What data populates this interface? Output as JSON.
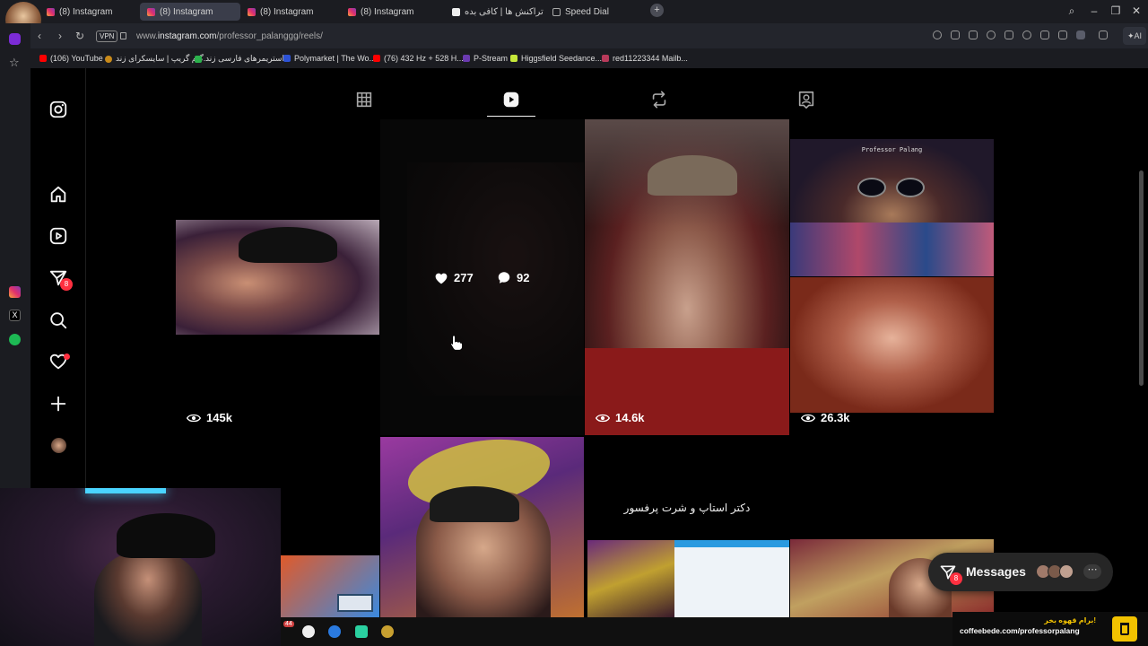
{
  "tabs": [
    {
      "label": "(8) Instagram"
    },
    {
      "label": "(8) Instagram"
    },
    {
      "label": "(8) Instagram"
    },
    {
      "label": "(8) Instagram"
    },
    {
      "label": "تراکنش ها | کافی بده"
    },
    {
      "label": "Speed Dial"
    }
  ],
  "address": {
    "vpn": "VPN",
    "url_prefix": "www.",
    "url_domain": "instagram.com",
    "url_path": "/professor_palanggg/reels/"
  },
  "bookmarks": [
    {
      "label": "(106) YouTube"
    },
    {
      "label": "گیم گریپ | سایسکرای زند..."
    },
    {
      "label": "استریمرهای فارسی زند..."
    },
    {
      "label": "Polymarket | The Wo..."
    },
    {
      "label": "(76) 432 Hz + 528 H..."
    },
    {
      "label": "P-Stream"
    },
    {
      "label": "Higgsfield Seedance..."
    },
    {
      "label": "red11223344 Mailb..."
    }
  ],
  "nav": {
    "notifications_badge": "8"
  },
  "grid": {
    "reel1_views": "145k",
    "reel2_likes": "277",
    "reel2_comments": "92",
    "reel3_views": "14.6k",
    "reel4_views": "26.3k",
    "reel4_caption": "Professor Palang",
    "reel7_caption": "دکتر استاپ و شرت پرفسور"
  },
  "messages": {
    "label": "Messages",
    "badge": "8"
  },
  "overlay": {
    "coffee_title": "برام قهوه بخر!",
    "coffee_url": "coffeebede.com/professorpalang",
    "taskbar_count": "44"
  },
  "colors": {
    "accent": "#ff3040",
    "bg": "#000000"
  }
}
